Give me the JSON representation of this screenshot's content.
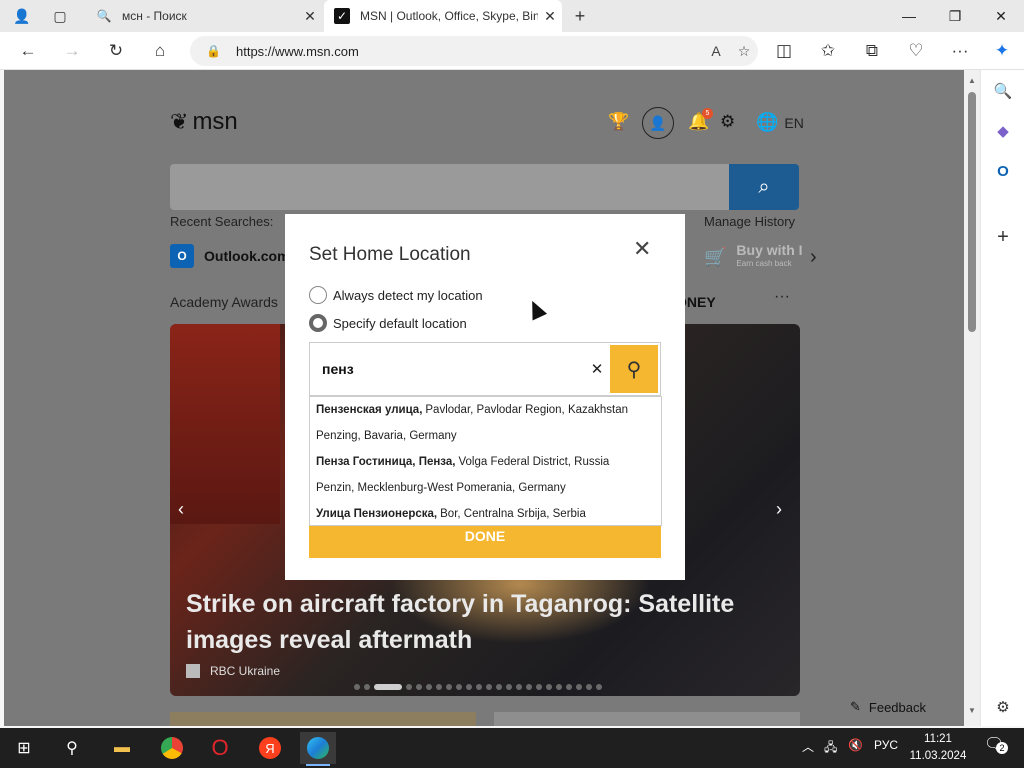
{
  "browser": {
    "tabs": [
      {
        "title": "мсн - Поиск",
        "icon": "search-icon"
      },
      {
        "title": "MSN | Outlook, Office, Skype, Bin",
        "icon": "msn-icon"
      }
    ],
    "address_url": "https://www.msn.com",
    "window_controls": [
      "minimize-icon",
      "restore-icon",
      "close-icon"
    ]
  },
  "msn": {
    "logo_text": "msn",
    "notification_count": "5",
    "language": "EN",
    "recent_searches_label": "Recent Searches:",
    "manage_history_label": "Manage History",
    "quick_links": {
      "outlook": "Outlook.com",
      "outlook_badge": "O",
      "buy": "Buy with I",
      "buy_sub": "Earn cash back"
    },
    "category_left": "Academy Awards",
    "category_right": "ONEY",
    "more_label": "···",
    "hero": {
      "headline": "Strike on aircraft factory in Taganrog: Satellite images reveal aftermath",
      "source": "RBC Ukraine"
    },
    "feedback_label": "Feedback"
  },
  "modal": {
    "title": "Set Home Location",
    "options": [
      {
        "label": "Always detect my location",
        "checked": false
      },
      {
        "label": "Specify default location",
        "checked": true
      }
    ],
    "input_value": "пенз",
    "suggestions": [
      {
        "bold": "Пензенская улица,",
        "rest": "Pavlodar, Pavlodar Region, Kazakhstan"
      },
      {
        "bold": "",
        "rest": "Penzing, Bavaria, Germany"
      },
      {
        "bold": "Пенза Гостиница, Пенза,",
        "rest": "Volga Federal District, Russia"
      },
      {
        "bold": "",
        "rest": "Penzin, Mecklenburg-West Pomerania, Germany"
      },
      {
        "bold": "Улица Пензионерска,",
        "rest": "Bor, Centralna Srbija, Serbia"
      }
    ],
    "done_label": "DONE"
  },
  "taskbar": {
    "language": "РУС",
    "time": "11:21",
    "date": "11.03.2024",
    "notifications": "2",
    "yandex_label": "Я"
  }
}
